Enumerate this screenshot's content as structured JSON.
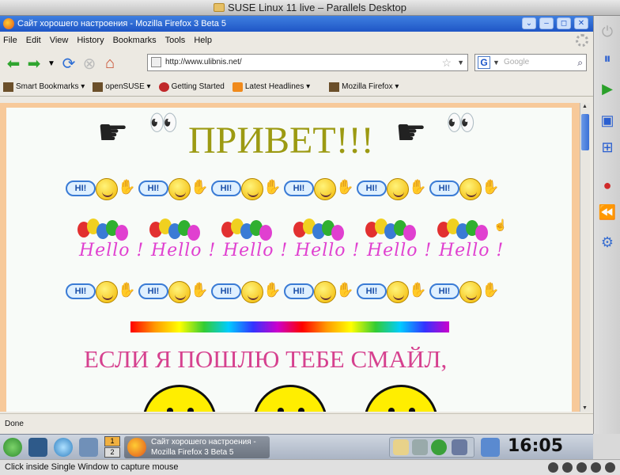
{
  "mac_window": {
    "title": "SUSE Linux 11 live – Parallels Desktop"
  },
  "firefox": {
    "title": "Сайт хорошего настроения - Mozilla Firefox 3 Beta 5",
    "menu": [
      "File",
      "Edit",
      "View",
      "History",
      "Bookmarks",
      "Tools",
      "Help"
    ],
    "url": "http://www.ulibnis.net/",
    "search_placeholder": "Google",
    "bookmarks": [
      "Smart Bookmarks",
      "openSUSE",
      "Getting Started",
      "Latest Headlines",
      "Mozilla Firefox"
    ],
    "status": "Done"
  },
  "page": {
    "heading": "ПРИВЕТ!!!",
    "hi_label": "HI!",
    "hello_label": "Hello !",
    "subheading": "ЕСЛИ Я ПОШЛЮ ТЕБЕ СМАЙЛ,"
  },
  "taskbar": {
    "pager": [
      "1",
      "2"
    ],
    "active_pager": "1",
    "task_line1": "Сайт хорошего настроения -",
    "task_line2": "Mozilla Firefox 3 Beta 5",
    "clock": "16:05"
  },
  "hint": "Click inside Single Window to capture mouse",
  "colors": {
    "heading": "#9c9a12",
    "subheading": "#d6418f",
    "page_frame": "#f7c99a",
    "titlebar": "#2a63d2"
  }
}
